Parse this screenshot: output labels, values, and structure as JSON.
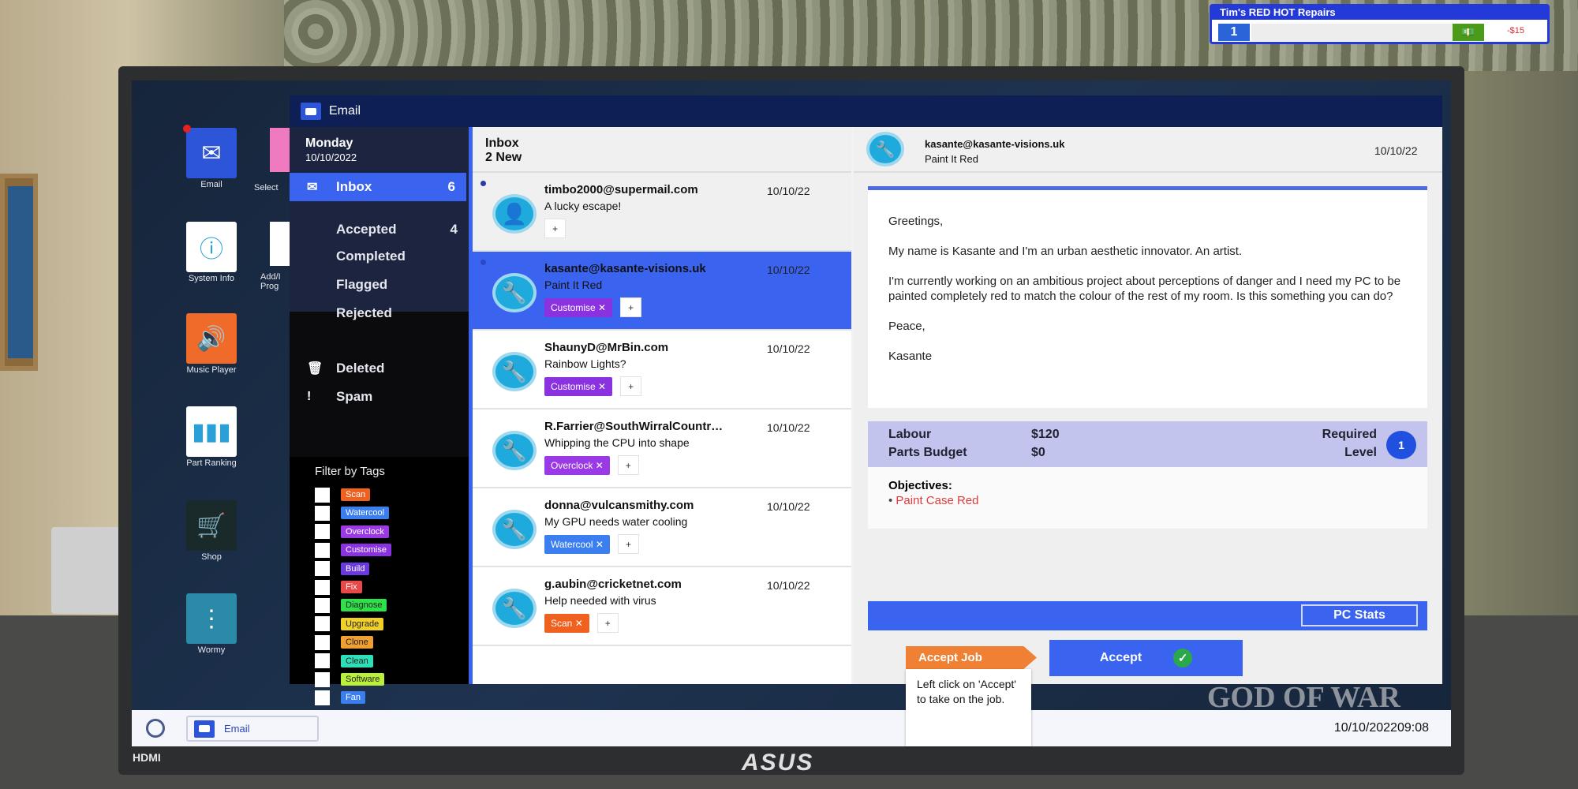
{
  "hud": {
    "title": "Tim's RED HOT Repairs",
    "level": "1",
    "money": "-$15",
    "cash_icon": "cash-icon"
  },
  "desktop": {
    "icons": [
      {
        "label": "Email",
        "icon": "envelope-icon",
        "color": "#2d55d9"
      },
      {
        "label": "System Info",
        "icon": "info-icon",
        "color": "#ffffff"
      },
      {
        "label": "Music Player",
        "icon": "speaker-icon",
        "color": "#f06a2a"
      },
      {
        "label": "Part Ranking",
        "icon": "bar-chart-icon",
        "color": "#ffffff"
      },
      {
        "label": "Shop",
        "icon": "cart-icon",
        "color": "#1a2a2a"
      },
      {
        "label": "Wormy",
        "icon": "snake-icon",
        "color": "#2a8aa8"
      }
    ],
    "partial_labels": [
      "Select",
      "Add/I Prog"
    ]
  },
  "window": {
    "title": "Email"
  },
  "nav": {
    "day": "Monday",
    "date": "10/10/2022",
    "items": [
      {
        "label": "Inbox",
        "count": "6"
      },
      {
        "label": "Accepted",
        "count": "4"
      },
      {
        "label": "Completed"
      },
      {
        "label": "Flagged"
      },
      {
        "label": "Rejected"
      },
      {
        "label": "Deleted"
      },
      {
        "label": "Spam"
      }
    ],
    "filter_title": "Filter by Tags",
    "tags": [
      {
        "label": "Scan",
        "color": "#f0601e"
      },
      {
        "label": "Watercool",
        "color": "#3a7ef0"
      },
      {
        "label": "Overclock",
        "color": "#9a3ae6"
      },
      {
        "label": "Customise",
        "color": "#8a32e0"
      },
      {
        "label": "Build",
        "color": "#6a3ae0"
      },
      {
        "label": "Fix",
        "color": "#e84848"
      },
      {
        "label": "Diagnose",
        "color": "#2ee04a"
      },
      {
        "label": "Upgrade",
        "color": "#f2d02a"
      },
      {
        "label": "Clone",
        "color": "#f0a030"
      },
      {
        "label": "Clean",
        "color": "#2ee0b8"
      },
      {
        "label": "Software",
        "color": "#b8f03a"
      },
      {
        "label": "Fan",
        "color": "#3a7ef0"
      }
    ]
  },
  "inbox": {
    "title": "Inbox",
    "subtitle": "2 New",
    "messages": [
      {
        "from": "timbo2000@supermail.com",
        "subject": "A lucky escape!",
        "date": "10/10/22",
        "tags": [],
        "unread": true,
        "avatar": "person-icon"
      },
      {
        "from": "kasante@kasante-visions.uk",
        "subject": "Paint It Red",
        "date": "10/10/22",
        "tags": [
          {
            "label": "Customise",
            "color": "#8a32e0"
          }
        ],
        "unread": true,
        "selected": true,
        "avatar": "wrench-icon"
      },
      {
        "from": "ShaunyD@MrBin.com",
        "subject": "Rainbow Lights?",
        "date": "10/10/22",
        "tags": [
          {
            "label": "Customise",
            "color": "#8a32e0"
          }
        ],
        "avatar": "wrench-icon"
      },
      {
        "from": "R.Farrier@SouthWirralCountr…",
        "subject": "Whipping the CPU into shape",
        "date": "10/10/22",
        "tags": [
          {
            "label": "Overclock",
            "color": "#9a3ae6"
          }
        ],
        "avatar": "wrench-icon"
      },
      {
        "from": "donna@vulcansmithy.com",
        "subject": "My GPU needs water cooling",
        "date": "10/10/22",
        "tags": [
          {
            "label": "Watercool",
            "color": "#3a7ef0"
          }
        ],
        "avatar": "wrench-icon"
      },
      {
        "from": "g.aubin@cricketnet.com",
        "subject": "Help needed with virus",
        "date": "10/10/22",
        "tags": [
          {
            "label": "Scan",
            "color": "#f0601e"
          }
        ],
        "avatar": "wrench-icon"
      }
    ]
  },
  "reading": {
    "from": "kasante@kasante-visions.uk",
    "subject": "Paint It Red",
    "date": "10/10/22",
    "body": [
      "Greetings,",
      "My name is Kasante and I'm an urban aesthetic innovator. An artist.",
      "I'm currently working on an ambitious project about perceptions of danger and I need my PC to be painted completely red to match the colour of the rest of my room. Is this something you can do?",
      "Peace,",
      "Kasante"
    ],
    "labour_label": "Labour",
    "labour": "$120",
    "parts_label": "Parts Budget",
    "parts": "$0",
    "required_label": "Required",
    "level_label": "Level",
    "required_level": "1",
    "objectives_title": "Objectives:",
    "objectives": [
      "Paint Case Red"
    ],
    "pc_stats": "PC Stats",
    "accept": "Accept"
  },
  "tooltip": {
    "title": "Accept Job",
    "text": "Left click on 'Accept' to take on the job."
  },
  "taskbar": {
    "email": "Email",
    "clock": "10/10/202209:08"
  },
  "monitor": {
    "brand": "ASUS",
    "input": "HDMI",
    "wallpaper_logo": "GOD OF WAR"
  }
}
